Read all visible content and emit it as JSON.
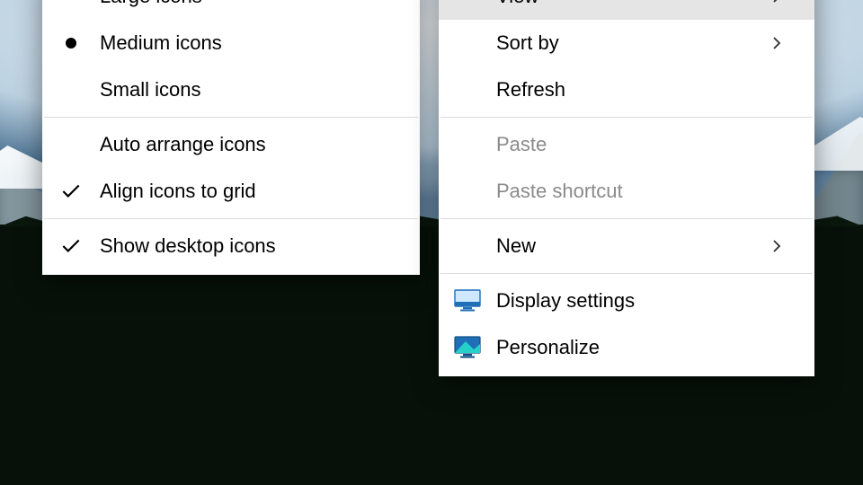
{
  "submenu": {
    "items": [
      {
        "label": "Large icons"
      },
      {
        "label": "Medium icons"
      },
      {
        "label": "Small icons"
      },
      {
        "label": "Auto arrange icons"
      },
      {
        "label": "Align icons to grid"
      },
      {
        "label": "Show desktop icons"
      }
    ]
  },
  "menu": {
    "items": [
      {
        "label": "View"
      },
      {
        "label": "Sort by"
      },
      {
        "label": "Refresh"
      },
      {
        "label": "Paste"
      },
      {
        "label": "Paste shortcut"
      },
      {
        "label": "New"
      },
      {
        "label": "Display settings"
      },
      {
        "label": "Personalize"
      }
    ]
  }
}
